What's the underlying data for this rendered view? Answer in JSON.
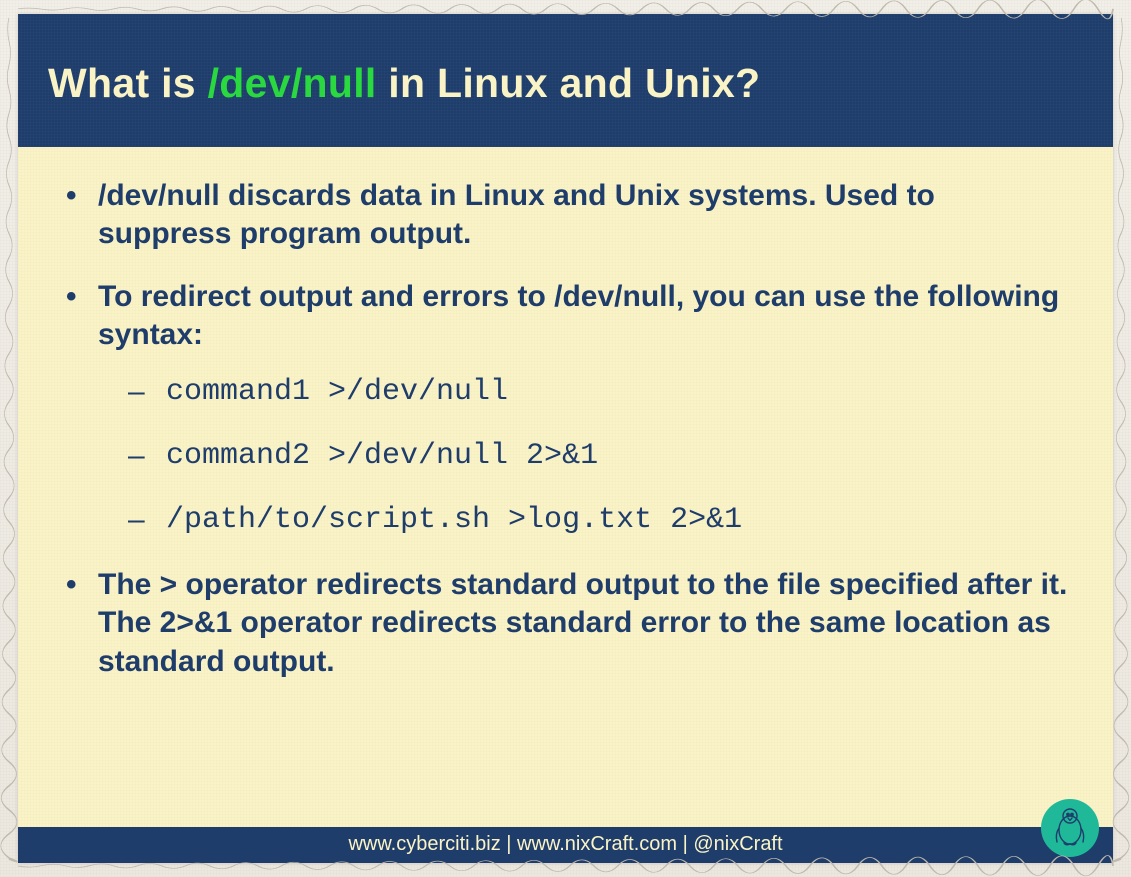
{
  "header": {
    "prefix": "What is ",
    "highlight": "/dev/null",
    "suffix": " in Linux and Unix?"
  },
  "bullets": {
    "b1": "/dev/null discards data in Linux and Unix systems. Used to suppress program output.",
    "b2": "To redirect output and errors to /dev/null, you can use the following syntax:",
    "b3": "The > operator redirects standard output to the file specified after it. The 2>&1 operator redirects standard error to the same location as standard output."
  },
  "commands": {
    "c1": "command1 >/dev/null",
    "c2": "command2 >/dev/null 2>&1",
    "c3": "/path/to/script.sh >log.txt 2>&1"
  },
  "footer": "www.cyberciti.biz | www.nixCraft.com | @nixCraft"
}
